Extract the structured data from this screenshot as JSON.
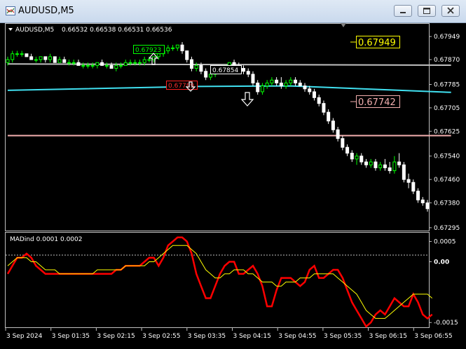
{
  "window": {
    "title": "AUDUSD,M5"
  },
  "price_info": {
    "symbol_text": "AUDUSD,M5",
    "ohlc": "0.66532 0.66538 0.66531 0.66536"
  },
  "indicator": {
    "name": "MADind 0.0001 0.0002"
  },
  "price_axis_labels": [
    "0.67949",
    "0.67870",
    "0.67785",
    "0.67705",
    "0.67625",
    "0.67540",
    "0.67460",
    "0.67380",
    "0.67295"
  ],
  "indicator_axis_labels": [
    "0.0005",
    "0.00",
    "-0.0015"
  ],
  "time_axis_labels": [
    "3 Sep 2024",
    "3 Sep 01:35",
    "3 Sep 02:15",
    "3 Sep 02:55",
    "3 Sep 03:35",
    "3 Sep 04:15",
    "3 Sep 04:55",
    "3 Sep 05:35",
    "3 Sep 06:15",
    "3 Sep 06:55"
  ],
  "level_tags": {
    "upper": "0.67949",
    "lower": "0.67742"
  },
  "trade_tags": {
    "green": "0.67923",
    "red": "0.67789",
    "white": "0.67854"
  },
  "colors": {
    "background": "#000000",
    "bull": "#00ff00",
    "bear": "#ffffff",
    "upper_tag": "#ffff00",
    "lower_tag": "#f4b0b0",
    "cyan_line": "#40e0f0",
    "gray_line": "#c0c0c0",
    "pink_line": "#f4b0b0",
    "mad_fast": "#ff0000",
    "mad_slow": "#ffff00"
  },
  "chart_data": [
    {
      "type": "candlestick",
      "title": "AUDUSD,M5",
      "ylim": [
        0.6729,
        0.6799
      ],
      "y_ticks": [
        0.67949,
        0.6787,
        0.67785,
        0.67705,
        0.67625,
        0.6754,
        0.6746,
        0.6738,
        0.67295
      ],
      "levels": [
        {
          "name": "upper",
          "value": 0.67949,
          "color": "#ffff00"
        },
        {
          "name": "lower",
          "value": 0.67742,
          "color": "#f4b0b0"
        }
      ],
      "series": [
        {
          "name": "gray_line",
          "color": "#c0c0c0",
          "values": [
            [
              0,
              0.67855
            ],
            [
              94,
              0.67851
            ]
          ]
        },
        {
          "name": "cyan_line",
          "color": "#40e0f0",
          "values": [
            [
              0,
              0.67765
            ],
            [
              40,
              0.67778
            ],
            [
              60,
              0.6778
            ],
            [
              94,
              0.67758
            ]
          ]
        },
        {
          "name": "pink_line",
          "color": "#f4b0b0",
          "values": [
            [
              0,
              0.6761
            ],
            [
              94,
              0.6761
            ]
          ]
        }
      ],
      "candles": [
        [
          0.6786,
          0.6788,
          0.6785,
          0.6787
        ],
        [
          0.6787,
          0.679,
          0.6786,
          0.6789
        ],
        [
          0.6789,
          0.679,
          0.6788,
          0.6789
        ],
        [
          0.6789,
          0.679,
          0.6788,
          0.6789
        ],
        [
          0.6789,
          0.6789,
          0.6788,
          0.6788
        ],
        [
          0.6788,
          0.6789,
          0.6787,
          0.6787
        ],
        [
          0.6787,
          0.6788,
          0.6786,
          0.6787
        ],
        [
          0.6787,
          0.6788,
          0.6786,
          0.6788
        ],
        [
          0.6788,
          0.6788,
          0.6786,
          0.6787
        ],
        [
          0.6787,
          0.6789,
          0.6786,
          0.6788
        ],
        [
          0.6788,
          0.6788,
          0.6786,
          0.6786
        ],
        [
          0.6786,
          0.6788,
          0.6786,
          0.6787
        ],
        [
          0.6787,
          0.6788,
          0.6786,
          0.6786
        ],
        [
          0.6786,
          0.6787,
          0.6785,
          0.6786
        ],
        [
          0.6786,
          0.6787,
          0.6785,
          0.6786
        ],
        [
          0.6786,
          0.6787,
          0.6785,
          0.6785
        ],
        [
          0.6785,
          0.6786,
          0.6784,
          0.6785
        ],
        [
          0.6785,
          0.6786,
          0.6784,
          0.6785
        ],
        [
          0.6785,
          0.6786,
          0.6784,
          0.6785
        ],
        [
          0.6785,
          0.6786,
          0.6784,
          0.6786
        ],
        [
          0.6786,
          0.6787,
          0.6785,
          0.6785
        ],
        [
          0.6785,
          0.6786,
          0.6784,
          0.6785
        ],
        [
          0.6785,
          0.6786,
          0.6784,
          0.6784
        ],
        [
          0.6784,
          0.6786,
          0.6783,
          0.6785
        ],
        [
          0.6785,
          0.6786,
          0.6784,
          0.6785
        ],
        [
          0.6785,
          0.6787,
          0.6785,
          0.6786
        ],
        [
          0.6786,
          0.6787,
          0.6785,
          0.6786
        ],
        [
          0.6786,
          0.6787,
          0.6785,
          0.6786
        ],
        [
          0.6786,
          0.6787,
          0.6785,
          0.6786
        ],
        [
          0.6786,
          0.6788,
          0.6785,
          0.6787
        ],
        [
          0.6787,
          0.6788,
          0.6786,
          0.6787
        ],
        [
          0.6787,
          0.6788,
          0.6786,
          0.6788
        ],
        [
          0.6788,
          0.679,
          0.6787,
          0.6789
        ],
        [
          0.6789,
          0.6792,
          0.6788,
          0.679
        ],
        [
          0.679,
          0.6792,
          0.6789,
          0.6791
        ],
        [
          0.6791,
          0.6792,
          0.679,
          0.6791
        ],
        [
          0.6791,
          0.6792,
          0.679,
          0.6792
        ],
        [
          0.6792,
          0.6793,
          0.6789,
          0.679
        ],
        [
          0.679,
          0.679,
          0.6786,
          0.6787
        ],
        [
          0.6787,
          0.6788,
          0.6783,
          0.6784
        ],
        [
          0.6784,
          0.6786,
          0.6783,
          0.6785
        ],
        [
          0.6785,
          0.6786,
          0.6782,
          0.6783
        ],
        [
          0.6783,
          0.6784,
          0.678,
          0.6781
        ],
        [
          0.6781,
          0.6783,
          0.678,
          0.6782
        ],
        [
          0.6782,
          0.6784,
          0.6781,
          0.6783
        ],
        [
          0.6783,
          0.6785,
          0.6782,
          0.6784
        ],
        [
          0.6784,
          0.6785,
          0.6783,
          0.6785
        ],
        [
          0.6785,
          0.6786,
          0.6784,
          0.6786
        ],
        [
          0.6786,
          0.6787,
          0.6784,
          0.6785
        ],
        [
          0.6785,
          0.6786,
          0.6783,
          0.6784
        ],
        [
          0.6784,
          0.6785,
          0.6782,
          0.6783
        ],
        [
          0.6783,
          0.6784,
          0.6781,
          0.6782
        ],
        [
          0.6782,
          0.6783,
          0.6778,
          0.6779
        ],
        [
          0.6779,
          0.678,
          0.6775,
          0.6776
        ],
        [
          0.6776,
          0.6779,
          0.6775,
          0.6778
        ],
        [
          0.6778,
          0.678,
          0.6777,
          0.6779
        ],
        [
          0.6779,
          0.6781,
          0.6778,
          0.678
        ],
        [
          0.678,
          0.6781,
          0.6778,
          0.6779
        ],
        [
          0.6779,
          0.6781,
          0.6777,
          0.6778
        ],
        [
          0.6778,
          0.678,
          0.6777,
          0.6779
        ],
        [
          0.6779,
          0.6781,
          0.6778,
          0.678
        ],
        [
          0.678,
          0.6781,
          0.6778,
          0.6779
        ],
        [
          0.6779,
          0.678,
          0.6778,
          0.6778
        ],
        [
          0.6778,
          0.6779,
          0.6776,
          0.6777
        ],
        [
          0.6777,
          0.6778,
          0.6775,
          0.6776
        ],
        [
          0.6776,
          0.6777,
          0.6773,
          0.6774
        ],
        [
          0.6774,
          0.6775,
          0.6771,
          0.6772
        ],
        [
          0.6772,
          0.6773,
          0.6768,
          0.6769
        ],
        [
          0.6769,
          0.677,
          0.6765,
          0.6766
        ],
        [
          0.6766,
          0.6767,
          0.6762,
          0.6763
        ],
        [
          0.6763,
          0.6764,
          0.6759,
          0.676
        ],
        [
          0.676,
          0.6761,
          0.6756,
          0.6757
        ],
        [
          0.6757,
          0.6758,
          0.6754,
          0.6755
        ],
        [
          0.6755,
          0.6756,
          0.6752,
          0.6753
        ],
        [
          0.6753,
          0.6755,
          0.6751,
          0.6754
        ],
        [
          0.6754,
          0.6755,
          0.6751,
          0.6752
        ],
        [
          0.6752,
          0.6753,
          0.675,
          0.6751
        ],
        [
          0.6751,
          0.6753,
          0.675,
          0.6752
        ],
        [
          0.6752,
          0.6753,
          0.6749,
          0.675
        ],
        [
          0.675,
          0.6752,
          0.6749,
          0.6751
        ],
        [
          0.6751,
          0.6753,
          0.6749,
          0.675
        ],
        [
          0.675,
          0.6752,
          0.6748,
          0.6749
        ],
        [
          0.6749,
          0.6754,
          0.6748,
          0.6752
        ],
        [
          0.6752,
          0.6755,
          0.675,
          0.6751
        ],
        [
          0.6751,
          0.6752,
          0.6745,
          0.6746
        ],
        [
          0.6746,
          0.6748,
          0.6743,
          0.6745
        ],
        [
          0.6745,
          0.6746,
          0.6741,
          0.6742
        ],
        [
          0.6742,
          0.6743,
          0.6738,
          0.6739
        ],
        [
          0.6739,
          0.674,
          0.6737,
          0.6738
        ],
        [
          0.6738,
          0.6739,
          0.6735,
          0.6736
        ]
      ]
    },
    {
      "type": "line",
      "title": "MADind 0.0001 0.0002",
      "ylim": [
        -0.0016,
        0.0007
      ],
      "y_ticks": [
        0.0005,
        0.0,
        -0.0015
      ],
      "series": [
        {
          "name": "fast",
          "color": "#ff0000",
          "values": [
            -0.0003,
            -0.0001,
            0.0001,
            0.0001,
            0.0002,
            0.0001,
            -0.0001,
            -0.0002,
            -0.0003,
            -0.0003,
            -0.0003,
            -0.0003,
            -0.0003,
            -0.0003,
            -0.0003,
            -0.0003,
            -0.0003,
            -0.0003,
            -0.0003,
            -0.0003,
            -0.0003,
            -0.0003,
            -0.0003,
            -0.0002,
            -0.0002,
            -0.0001,
            -0.0001,
            -0.0001,
            -0.0001,
            0.0,
            0.0001,
            0.0001,
            -0.0001,
            0.0001,
            0.0004,
            0.0005,
            0.0006,
            0.0006,
            0.0005,
            0.0002,
            -0.0003,
            -0.0006,
            -0.0009,
            -0.0009,
            -0.0006,
            -0.0003,
            -0.0001,
            0.0,
            0.0,
            -0.0003,
            -0.0003,
            -0.0002,
            -0.0001,
            -0.0003,
            -0.0006,
            -0.0011,
            -0.0011,
            -0.0007,
            -0.0004,
            -0.0004,
            -0.0004,
            -0.0005,
            -0.0006,
            -0.0005,
            -0.0002,
            -0.0001,
            -0.0004,
            -0.0004,
            -0.0003,
            -0.0002,
            -0.0002,
            -0.0004,
            -0.0007,
            -0.001,
            -0.0012,
            -0.0014,
            -0.0016,
            -0.0015,
            -0.0013,
            -0.0012,
            -0.0013,
            -0.0011,
            -0.0009,
            -0.001,
            -0.0011,
            -0.0011,
            -0.0008,
            -0.001,
            -0.0013,
            -0.0014,
            -0.0013
          ]
        },
        {
          "name": "slow",
          "color": "#ffff00",
          "values": [
            -0.0001,
            0.0,
            0.0001,
            0.0001,
            0.0001,
            0.0,
            0.0,
            -0.0001,
            -0.0002,
            -0.0002,
            -0.0002,
            -0.0003,
            -0.0003,
            -0.0003,
            -0.0003,
            -0.0003,
            -0.0003,
            -0.0003,
            -0.0003,
            -0.0002,
            -0.0002,
            -0.0002,
            -0.0002,
            -0.0002,
            -0.0002,
            -0.0001,
            -0.0001,
            -0.0001,
            -0.0001,
            -0.0001,
            0.0,
            0.0,
            0.0001,
            0.0002,
            0.0003,
            0.0004,
            0.0004,
            0.0004,
            0.0004,
            0.0003,
            0.0002,
            0.0,
            -0.0002,
            -0.0003,
            -0.0004,
            -0.0004,
            -0.0003,
            -0.0003,
            -0.0002,
            -0.0002,
            -0.0002,
            -0.0003,
            -0.0003,
            -0.0004,
            -0.0005,
            -0.0005,
            -0.0005,
            -0.0006,
            -0.0006,
            -0.0005,
            -0.0005,
            -0.0005,
            -0.0004,
            -0.0004,
            -0.0004,
            -0.0003,
            -0.0003,
            -0.0003,
            -0.0003,
            -0.0003,
            -0.0004,
            -0.0005,
            -0.0006,
            -0.0007,
            -0.0008,
            -0.001,
            -0.0012,
            -0.0013,
            -0.0014,
            -0.0014,
            -0.0014,
            -0.0013,
            -0.0012,
            -0.0011,
            -0.001,
            -0.0009,
            -0.0008,
            -0.0008,
            -0.0008,
            -0.0008,
            -0.0009
          ]
        }
      ]
    }
  ]
}
